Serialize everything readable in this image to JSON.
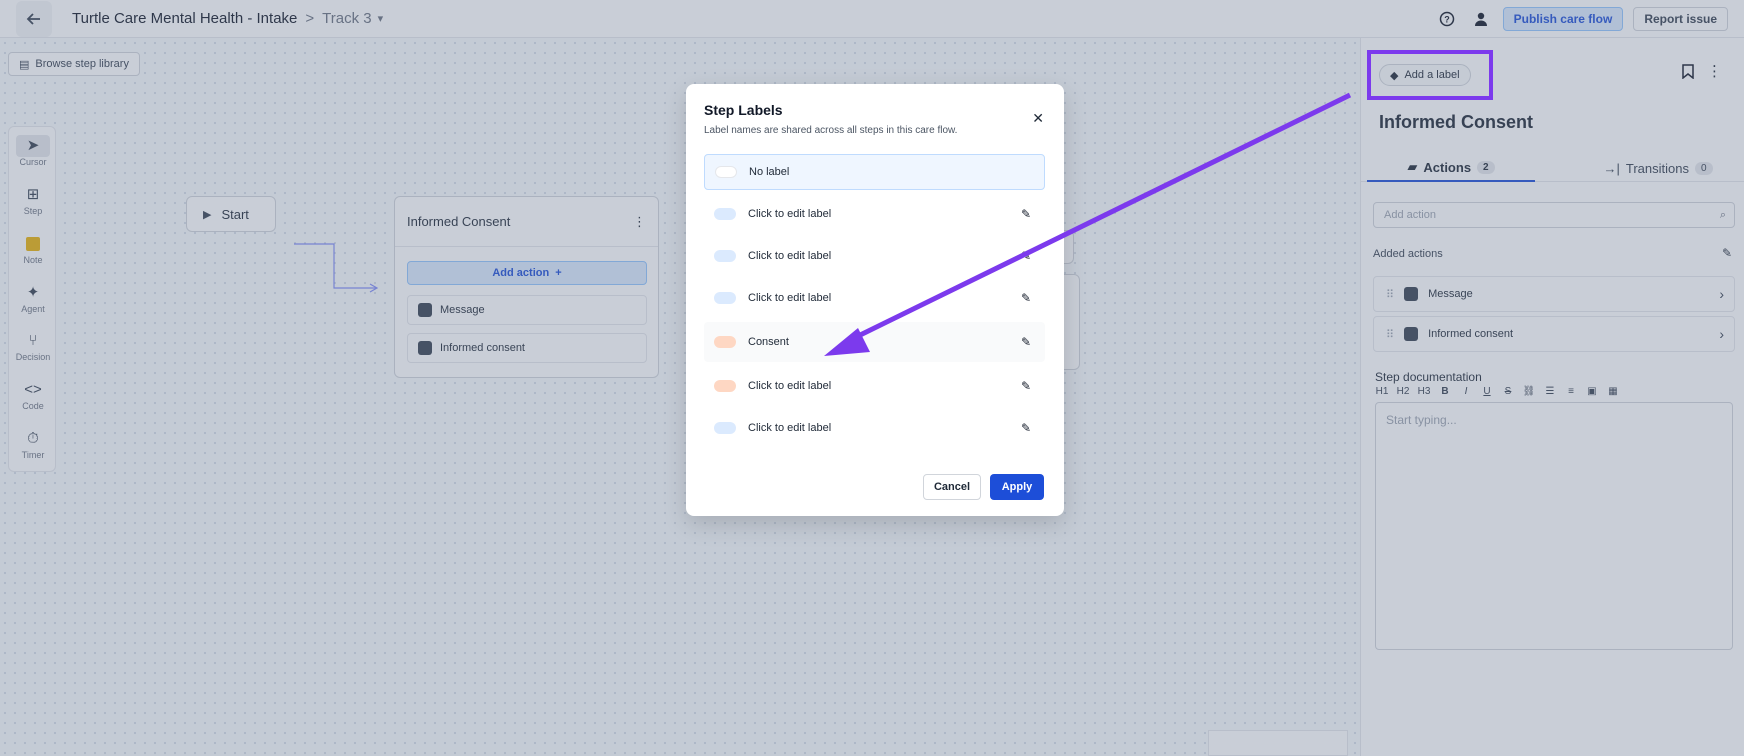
{
  "topbar": {
    "flow_title": "Turtle Care Mental Health - Intake",
    "separator": ">",
    "track": "Track 3",
    "publish_label": "Publish care flow",
    "report_label": "Report issue"
  },
  "canvas": {
    "library_label": "Browse step library",
    "tools": [
      {
        "icon": "cursor-icon",
        "label": "Cursor"
      },
      {
        "icon": "step-icon",
        "label": "Step"
      },
      {
        "icon": "note-icon",
        "label": "Note"
      },
      {
        "icon": "agent-icon",
        "label": "Agent"
      },
      {
        "icon": "decision-icon",
        "label": "Decision"
      },
      {
        "icon": "code-icon",
        "label": "Code"
      },
      {
        "icon": "timer-icon",
        "label": "Timer"
      }
    ],
    "start_label": "Start",
    "step_card": {
      "title": "Informed Consent",
      "add_action_label": "Add action",
      "actions": [
        "Message",
        "Informed consent"
      ]
    }
  },
  "panel": {
    "add_label": "Add a label",
    "title": "Informed Consent",
    "tabs": [
      {
        "label": "Actions",
        "count": "2"
      },
      {
        "label": "Transitions",
        "count": "0"
      }
    ],
    "search_placeholder": "Add action",
    "added_actions_title": "Added actions",
    "actions": [
      "Message",
      "Informed consent"
    ],
    "doc_title": "Step documentation",
    "doc_placeholder": "Start typing..."
  },
  "modal": {
    "title": "Step Labels",
    "subtitle": "Label names are shared across all steps in this care flow.",
    "labels": [
      {
        "text": "No label",
        "color": "#ffffff"
      },
      {
        "text": "Click to edit label",
        "color": "#dbeafe"
      },
      {
        "text": "Click to edit label",
        "color": "#dbeafe"
      },
      {
        "text": "Click to edit label",
        "color": "#dbeafe"
      },
      {
        "text": "Consent",
        "color": "#fed7c3"
      },
      {
        "text": "Click to edit label",
        "color": "#fed7c3"
      },
      {
        "text": "Click to edit label",
        "color": "#dbeafe"
      }
    ],
    "cancel_label": "Cancel",
    "apply_label": "Apply"
  },
  "colors": {
    "accent": "#1d4ed8",
    "annotation": "#7c3aed"
  }
}
